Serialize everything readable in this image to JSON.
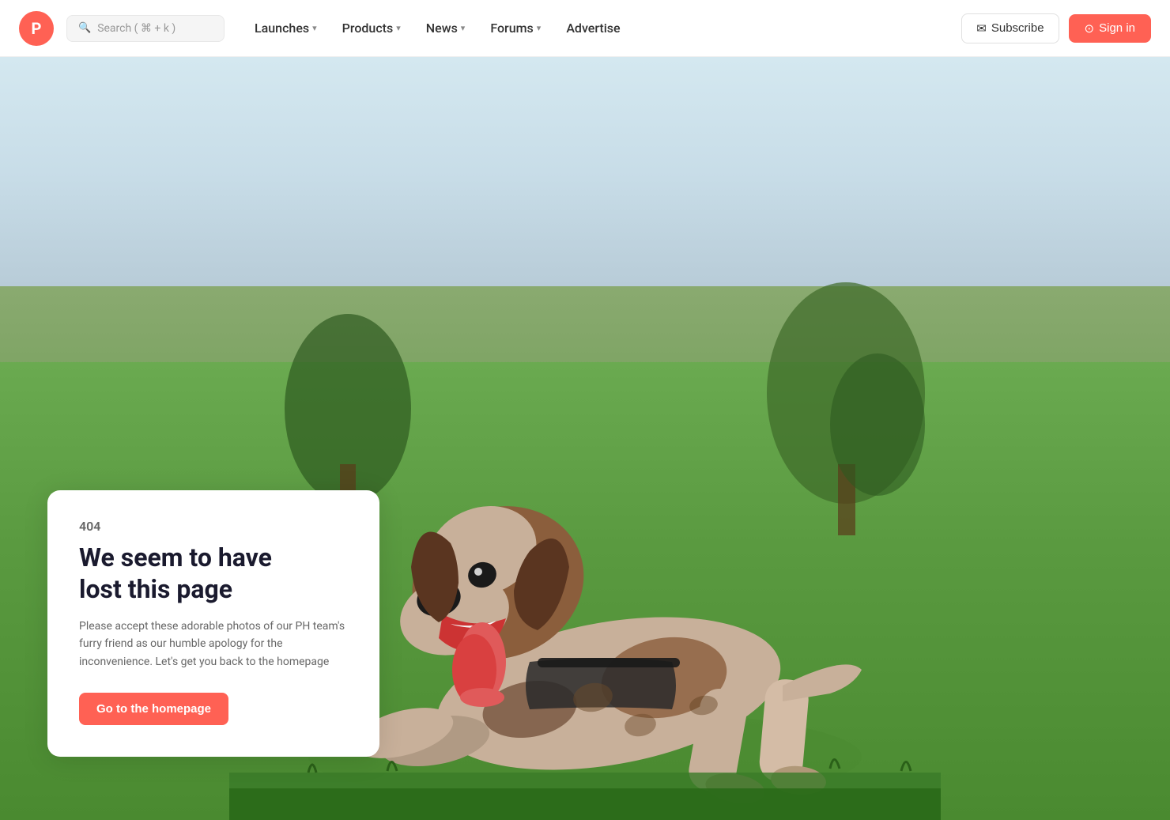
{
  "brand": {
    "logo_letter": "P",
    "logo_color": "#ff6154"
  },
  "navbar": {
    "search_placeholder": "Search ( ⌘ + k )",
    "nav_items": [
      {
        "label": "Launches",
        "has_dropdown": true
      },
      {
        "label": "Products",
        "has_dropdown": true
      },
      {
        "label": "News",
        "has_dropdown": true
      },
      {
        "label": "Forums",
        "has_dropdown": true
      },
      {
        "label": "Advertise",
        "has_dropdown": false
      }
    ],
    "subscribe_label": "Subscribe",
    "signin_label": "Sign in"
  },
  "error_page": {
    "code": "404",
    "title_line1": "We seem to have",
    "title_line2": "lost this page",
    "description": "Please accept these adorable photos of our PH team's furry friend as our humble apology for the inconvenience. Let's get you back to the homepage",
    "cta_label": "Go to the homepage"
  }
}
